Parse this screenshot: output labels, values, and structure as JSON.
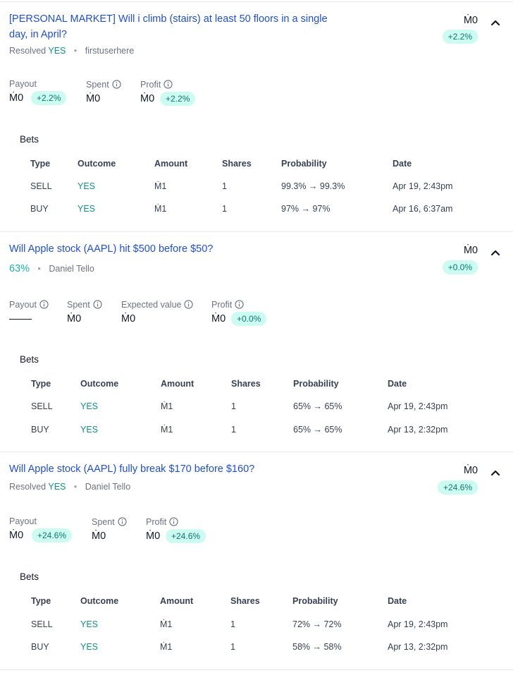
{
  "currency": "Ṁ",
  "labels": {
    "payout": "Payout",
    "spent": "Spent",
    "profit": "Profit",
    "expected_value": "Expected value",
    "bets": "Bets",
    "col_type": "Type",
    "col_outcome": "Outcome",
    "col_amount": "Amount",
    "col_shares": "Shares",
    "col_probability": "Probability",
    "col_date": "Date"
  },
  "markets": [
    {
      "title": "[PERSONAL MARKET] Will i climb (stairs) at least 50 floors in a single day, in April?",
      "status_prefix": "Resolved",
      "status_value": "YES",
      "creator": "firstuserhere",
      "value": "Ṁ0",
      "change": "+2.2%",
      "payout": "Ṁ0",
      "payout_change": "+2.2%",
      "spent": "Ṁ0",
      "profit": "Ṁ0",
      "profit_change": "+2.2%",
      "bets": [
        {
          "type": "SELL",
          "outcome": "YES",
          "amount": "Ṁ1",
          "shares": "1",
          "probability": "99.3% → 99.3%",
          "date": "Apr 19, 2:43pm"
        },
        {
          "type": "BUY",
          "outcome": "YES",
          "amount": "Ṁ1",
          "shares": "1",
          "probability": "97% → 97%",
          "date": "Apr 16, 6:37am"
        }
      ]
    },
    {
      "title": "Will Apple stock (AAPL) hit $500 before $50?",
      "probability": "63%",
      "creator": "Daniel Tello",
      "value": "Ṁ0",
      "change": "+0.0%",
      "payout": "",
      "spent": "Ṁ0",
      "expected_value": "Ṁ0",
      "profit": "Ṁ0",
      "profit_change": "+0.0%",
      "bets": [
        {
          "type": "SELL",
          "outcome": "YES",
          "amount": "Ṁ1",
          "shares": "1",
          "probability": "65% → 65%",
          "date": "Apr 19, 2:43pm"
        },
        {
          "type": "BUY",
          "outcome": "YES",
          "amount": "Ṁ1",
          "shares": "1",
          "probability": "65% → 65%",
          "date": "Apr 13, 2:32pm"
        }
      ]
    },
    {
      "title": "Will Apple stock (AAPL) fully break $170 before $160?",
      "status_prefix": "Resolved",
      "status_value": "YES",
      "creator": "Daniel Tello",
      "value": "Ṁ0",
      "change": "+24.6%",
      "payout": "Ṁ0",
      "payout_change": "+24.6%",
      "spent": "Ṁ0",
      "profit": "Ṁ0",
      "profit_change": "+24.6%",
      "bets": [
        {
          "type": "SELL",
          "outcome": "YES",
          "amount": "Ṁ1",
          "shares": "1",
          "probability": "72% → 72%",
          "date": "Apr 19, 2:43pm"
        },
        {
          "type": "BUY",
          "outcome": "YES",
          "amount": "Ṁ1",
          "shares": "1",
          "probability": "58% → 58%",
          "date": "Apr 13, 2:32pm"
        }
      ]
    }
  ],
  "colors": {
    "link": "#1d4ed8",
    "positive": "#0d9488",
    "chip_bg": "#ccfbf1",
    "muted": "#6b7280",
    "divider": "#e5e7eb"
  },
  "icons": {
    "collapse": "chevron-up-icon",
    "info": "info-icon"
  }
}
